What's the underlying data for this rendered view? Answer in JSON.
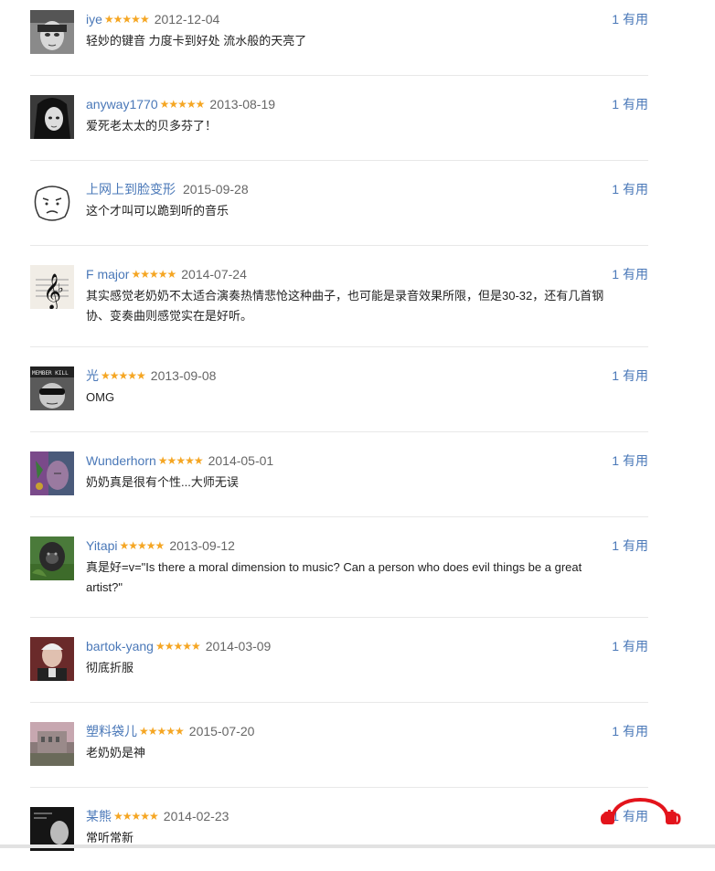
{
  "comments": [
    {
      "user": "iye",
      "stars": "★★★★★",
      "date": "2012-12-04",
      "text": "轻妙的键音 力度卡到好处 流水般的天亮了",
      "useful_count": "1",
      "useful_label": "有用",
      "avatar_icon": "woman-bw-avatar"
    },
    {
      "user": "anyway1770",
      "stars": "★★★★★",
      "date": "2013-08-19",
      "text": "爱死老太太的贝多芬了！",
      "useful_count": "1",
      "useful_label": "有用",
      "avatar_icon": "dark-hair-avatar"
    },
    {
      "user": "上网上到脸变形",
      "stars": "",
      "date": "2015-09-28",
      "text": "这个才叫可以跪到听的音乐",
      "useful_count": "1",
      "useful_label": "有用",
      "avatar_icon": "face-sketch-avatar"
    },
    {
      "user": "F major",
      "stars": "★★★★★",
      "date": "2014-07-24",
      "text": "其实感觉老奶奶不太适合演奏热情悲怆这种曲子，也可能是录音效果所限，但是30-32，还有几首钢协、变奏曲则感觉实在是好听。",
      "useful_count": "1",
      "useful_label": "有用",
      "avatar_icon": "treble-clef-avatar"
    },
    {
      "user": "光",
      "stars": "★★★★★",
      "date": "2013-09-08",
      "text": "OMG",
      "useful_count": "1",
      "useful_label": "有用",
      "avatar_icon": "sunglasses-avatar"
    },
    {
      "user": "Wunderhorn",
      "stars": "★★★★★",
      "date": "2014-05-01",
      "text": "奶奶真是很有个性...大师无误",
      "useful_count": "1",
      "useful_label": "有用",
      "avatar_icon": "painting-avatar"
    },
    {
      "user": "Yitapi",
      "stars": "★★★★★",
      "date": "2013-09-12",
      "text": "真是好=v=\"Is there a moral dimension to music? Can a person who does evil things be a great artist?\"",
      "useful_count": "1",
      "useful_label": "有用",
      "avatar_icon": "gorilla-avatar"
    },
    {
      "user": "bartok-yang",
      "stars": "★★★★★",
      "date": "2014-03-09",
      "text": "彻底折服",
      "useful_count": "1",
      "useful_label": "有用",
      "avatar_icon": "portrait-avatar"
    },
    {
      "user": "塑料袋儿",
      "stars": "★★★★★",
      "date": "2015-07-20",
      "text": "老奶奶是神",
      "useful_count": "1",
      "useful_label": "有用",
      "avatar_icon": "building-avatar"
    },
    {
      "user": "某熊",
      "stars": "★★★★★",
      "date": "2014-02-23",
      "text": "常听常新",
      "useful_count": "1",
      "useful_label": "有用",
      "avatar_icon": "album-cover-avatar"
    }
  ],
  "brand": {
    "logo_icon": "headphones-logo",
    "accent": "#e3141c"
  },
  "colors": {
    "link": "#4a78b8",
    "star": "#f5a623",
    "date": "#666666",
    "separator": "#e8e8e8"
  }
}
